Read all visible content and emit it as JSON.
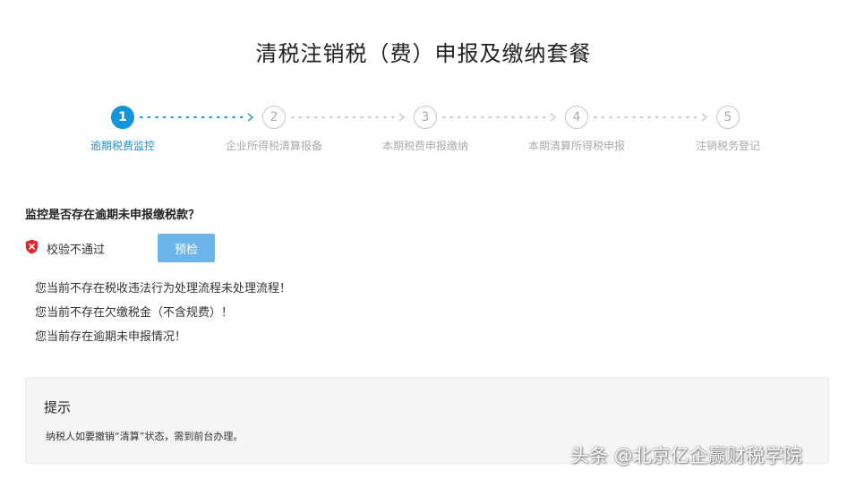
{
  "page": {
    "title": "清税注销税（费）申报及缴纳套餐"
  },
  "stepper": {
    "steps": [
      {
        "number": "1",
        "label": "逾期税费监控",
        "active": true
      },
      {
        "number": "2",
        "label": "企业所得税清算报备",
        "active": false
      },
      {
        "number": "3",
        "label": "本期税费申报缴纳",
        "active": false
      },
      {
        "number": "4",
        "label": "本期清算所得税申报",
        "active": false
      },
      {
        "number": "5",
        "label": "注销税务登记",
        "active": false
      }
    ],
    "colors": {
      "active": "#1296db",
      "inactive": "#c6c6c6"
    }
  },
  "monitor": {
    "question": "监控是否存在逾期未申报缴税款？",
    "status": {
      "icon": "error-shield-icon",
      "text": "校验不通过",
      "color": "#e0262b"
    },
    "precheck_label": "预检",
    "messages": [
      "您当前不存在税收违法行为处理流程未处理流程！",
      "您当前不存在欠缴税金（不含规费）！",
      "您当前存在逾期未申报情况！"
    ]
  },
  "tip": {
    "title": "提示",
    "text": "纳税人如要撤销“清算”状态，需到前台办理。"
  },
  "watermark": {
    "text": "头条 @北京亿企赢财税学院"
  }
}
